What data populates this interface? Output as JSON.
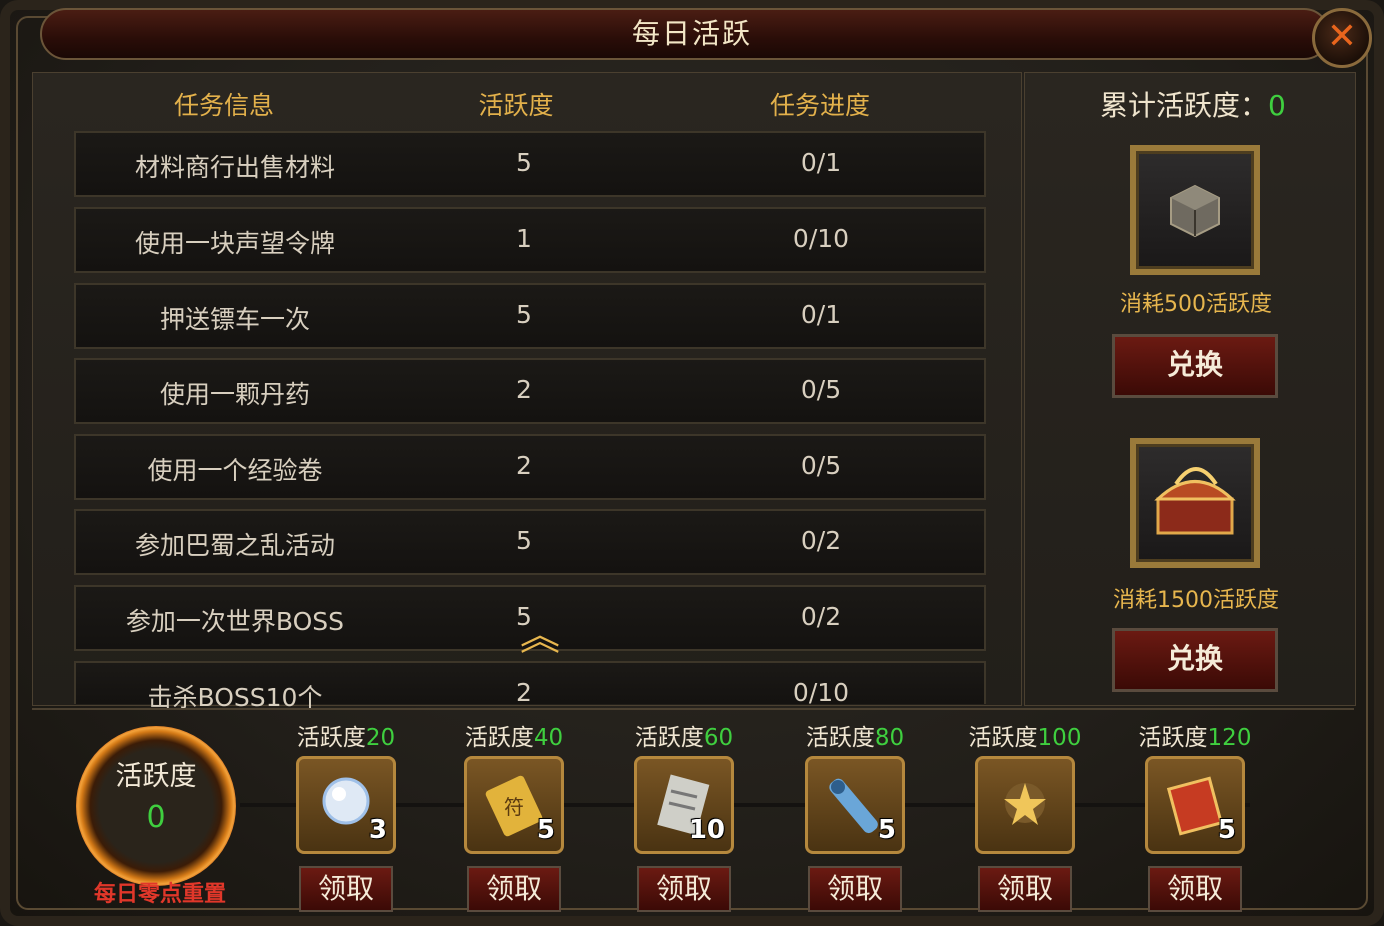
{
  "window": {
    "title": "每日活跃",
    "close_icon": "close-icon"
  },
  "table": {
    "headers": [
      "任务信息",
      "活跃度",
      "任务进度"
    ],
    "rows": [
      {
        "task": "材料商行出售材料",
        "points": "5",
        "progress": "0/1"
      },
      {
        "task": "使用一块声望令牌",
        "points": "1",
        "progress": "0/10"
      },
      {
        "task": "押送镖车一次",
        "points": "5",
        "progress": "0/1"
      },
      {
        "task": "使用一颗丹药",
        "points": "2",
        "progress": "0/5"
      },
      {
        "task": "使用一个经验卷",
        "points": "2",
        "progress": "0/5"
      },
      {
        "task": "参加巴蜀之乱活动",
        "points": "5",
        "progress": "0/2"
      },
      {
        "task": "参加一次世界BOSS",
        "points": "5",
        "progress": "0/2"
      },
      {
        "task": "击杀BOSS10个",
        "points": "2",
        "progress": "0/10"
      }
    ]
  },
  "exchange": {
    "total_label": "累计活跃度：",
    "total_value": "0",
    "items": [
      {
        "icon": "mystery-box-icon",
        "cost": "消耗500活跃度",
        "button": "兑换"
      },
      {
        "icon": "golden-chest-icon",
        "cost": "消耗1500活跃度",
        "button": "兑换"
      }
    ]
  },
  "activity": {
    "ring_label": "活跃度",
    "ring_value": "0",
    "reset_text": "每日零点重置"
  },
  "rewards": [
    {
      "label": "活跃度",
      "threshold": "20",
      "count": "3",
      "icon": "pearl-icon",
      "button": "领取"
    },
    {
      "label": "活跃度",
      "threshold": "40",
      "count": "5",
      "icon": "talisman-icon",
      "button": "领取"
    },
    {
      "label": "活跃度",
      "threshold": "60",
      "count": "10",
      "icon": "scroll-page-icon",
      "button": "领取"
    },
    {
      "label": "活跃度",
      "threshold": "80",
      "count": "5",
      "icon": "blue-scroll-icon",
      "button": "领取"
    },
    {
      "label": "活跃度",
      "threshold": "100",
      "count": "",
      "icon": "star-orb-icon",
      "button": "领取"
    },
    {
      "label": "活跃度",
      "threshold": "120",
      "count": "5",
      "icon": "red-book-icon",
      "button": "领取"
    }
  ],
  "colors": {
    "gold": "#e7b64e",
    "green": "#3fcf3f",
    "red": "#e1372a"
  }
}
